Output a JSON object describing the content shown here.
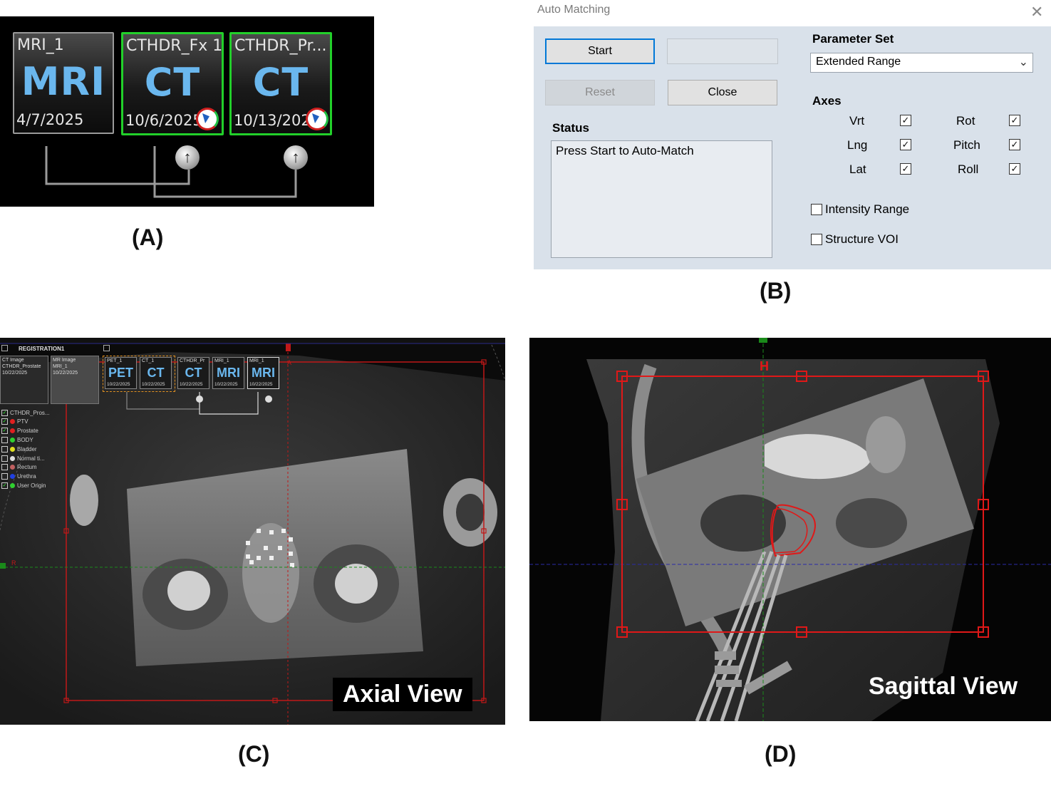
{
  "captions": {
    "a": "(A)",
    "b": "(B)",
    "c": "(C)",
    "d": "(D)"
  },
  "panel_a": {
    "thumbnails": [
      {
        "title": "MRI_1",
        "modality": "MRI",
        "date": "4/7/2025"
      },
      {
        "title": "CTHDR_Fx 1",
        "modality": "CT",
        "date": "10/6/2025"
      },
      {
        "title": "CTHDR_Pr...",
        "modality": "CT",
        "date": "10/13/2025"
      }
    ],
    "colors": {
      "selected_border": "#22d02a",
      "modality_text": "#6ab7ee"
    }
  },
  "dialog": {
    "title": "Auto Matching",
    "start_label": "Start",
    "reset_label": "Reset",
    "close_label": "Close",
    "status_heading": "Status",
    "status_text": "Press Start to Auto-Match",
    "parameter_set_heading": "Parameter Set",
    "parameter_set_value": "Extended Range",
    "axes_heading": "Axes",
    "axes": {
      "vrt": "Vrt",
      "lng": "Lng",
      "lat": "Lat",
      "rot": "Rot",
      "pitch": "Pitch",
      "roll": "Roll"
    },
    "intensity_range_label": "Intensity Range",
    "structure_voi_label": "Structure VOI"
  },
  "panel_c": {
    "registration_label": "REGISTRATION1",
    "top_thumbs": [
      {
        "line1": "CT Image",
        "line2": "CTHDR_Prostate",
        "date": "10/22/2025"
      },
      {
        "line1": "MR Image",
        "line2": "MRI_1",
        "date": "10/22/2025"
      }
    ],
    "small_thumbs": [
      {
        "title": "PET_1",
        "modality": "PET",
        "date": "10/22/2025"
      },
      {
        "title": "CT_1",
        "modality": "CT",
        "date": "10/22/2025"
      },
      {
        "title": "CTHDR_Pr",
        "modality": "CT",
        "date": "10/22/2025"
      },
      {
        "title": "MRI_1",
        "modality": "MRI",
        "date": "10/22/2025"
      },
      {
        "title": "MRI_1",
        "modality": "MRI",
        "date": "10/22/2025"
      }
    ],
    "structures": [
      {
        "name": "CTHDR_Pros...",
        "color": "",
        "checked": true
      },
      {
        "name": "PTV",
        "color": "#e02020",
        "checked": true
      },
      {
        "name": "Prostate",
        "color": "#e02020",
        "checked": true
      },
      {
        "name": "BODY",
        "color": "#30d030",
        "checked": false
      },
      {
        "name": "Bladder",
        "color": "#e0e020",
        "checked": false
      },
      {
        "name": "Normal ti...",
        "color": "#e0e0e0",
        "checked": false
      },
      {
        "name": "Rectum",
        "color": "#c06060",
        "checked": false
      },
      {
        "name": "Urethra",
        "color": "#2040e0",
        "checked": false
      },
      {
        "name": "User Origin",
        "color": "#30d030",
        "checked": true
      }
    ],
    "marker_a": "A",
    "marker_r": "R",
    "view_label": "Axial View"
  },
  "panel_d": {
    "marker_h": "H",
    "view_label": "Sagittal View"
  }
}
